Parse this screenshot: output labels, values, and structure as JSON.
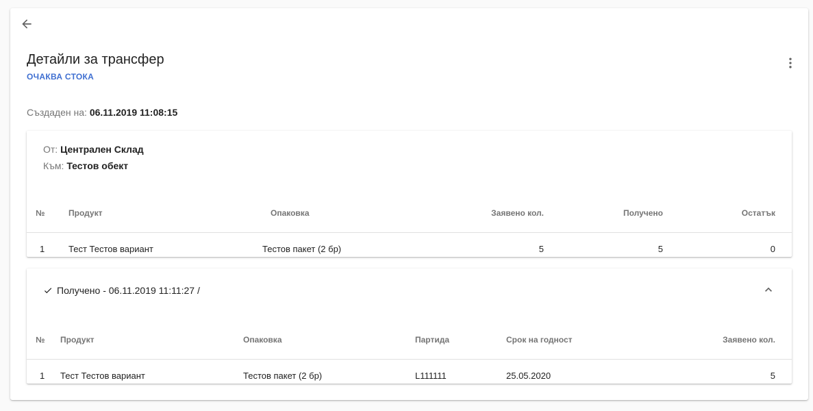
{
  "header": {
    "title": "Детайли за трансфер",
    "status": "ОЧАКВА СТОКА"
  },
  "created": {
    "label": "Създаден на:",
    "value": "06.11.2019 11:08:15"
  },
  "transfer": {
    "from_label": "От:",
    "from_value": "Централен Склад",
    "to_label": "Към:",
    "to_value": "Тестов обект",
    "columns": [
      "№",
      "Продукт",
      "Опаковка",
      "Заявено кол.",
      "Получено",
      "Остатък"
    ],
    "rows": [
      [
        "1",
        "Тест Тестов вариант",
        "Тестов пакет (2 бр)",
        "5",
        "5",
        "0"
      ]
    ]
  },
  "received": {
    "title": "Получено - 06.11.2019 11:11:27 /",
    "columns": [
      "№",
      "Продукт",
      "Опаковка",
      "Партида",
      "Срок на годност",
      "Заявено кол."
    ],
    "rows": [
      [
        "1",
        "Тест Тестов вариант",
        "Тестов пакет (2 бр)",
        "L111111",
        "25.05.2020",
        "5"
      ]
    ]
  },
  "icons": {
    "back": "arrow-back-icon",
    "more": "more-vert-icon",
    "check": "check-icon",
    "collapse": "chevron-up-icon"
  },
  "colors": {
    "status": "#3f6fd1",
    "muted": "#757575"
  }
}
